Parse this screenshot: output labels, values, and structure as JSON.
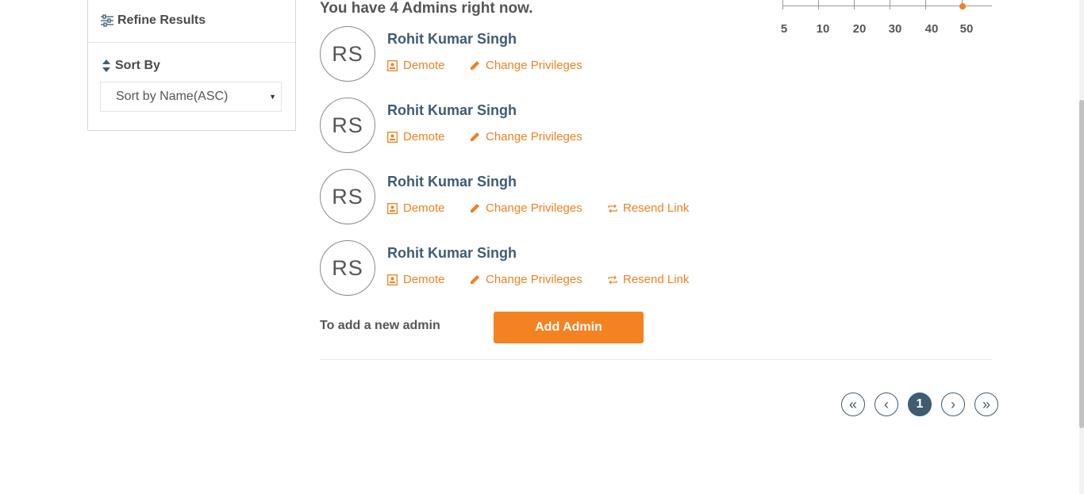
{
  "sidebar": {
    "title": "Refine Results",
    "sort_label": "Sort By",
    "sort_value": "Sort by Name(ASC)"
  },
  "main": {
    "headline": "You have 4 Admins right now.",
    "admins": [
      {
        "initials": "RS",
        "name": "Rohit Kumar Singh",
        "demote": "Demote",
        "privileges": "Change Privileges"
      },
      {
        "initials": "RS",
        "name": "Rohit Kumar Singh",
        "demote": "Demote",
        "privileges": "Change Privileges"
      },
      {
        "initials": "RS",
        "name": "Rohit Kumar Singh",
        "demote": "Demote",
        "privileges": "Change Privileges",
        "resend": "Resend Link"
      },
      {
        "initials": "RS",
        "name": "Rohit Kumar Singh",
        "demote": "Demote",
        "privileges": "Change Privileges",
        "resend": "Resend Link"
      }
    ],
    "add_label": "To add a new admin",
    "add_button": "Add Admin"
  },
  "page_size": {
    "ticks": [
      "5",
      "10",
      "20",
      "30",
      "40",
      "50"
    ],
    "selected": "50"
  },
  "pagination": {
    "first": "«",
    "prev": "‹",
    "current": "1",
    "next": "›",
    "last": "»"
  },
  "colors": {
    "accent": "#f58220",
    "link": "#f08121",
    "name": "#3f5c73"
  }
}
